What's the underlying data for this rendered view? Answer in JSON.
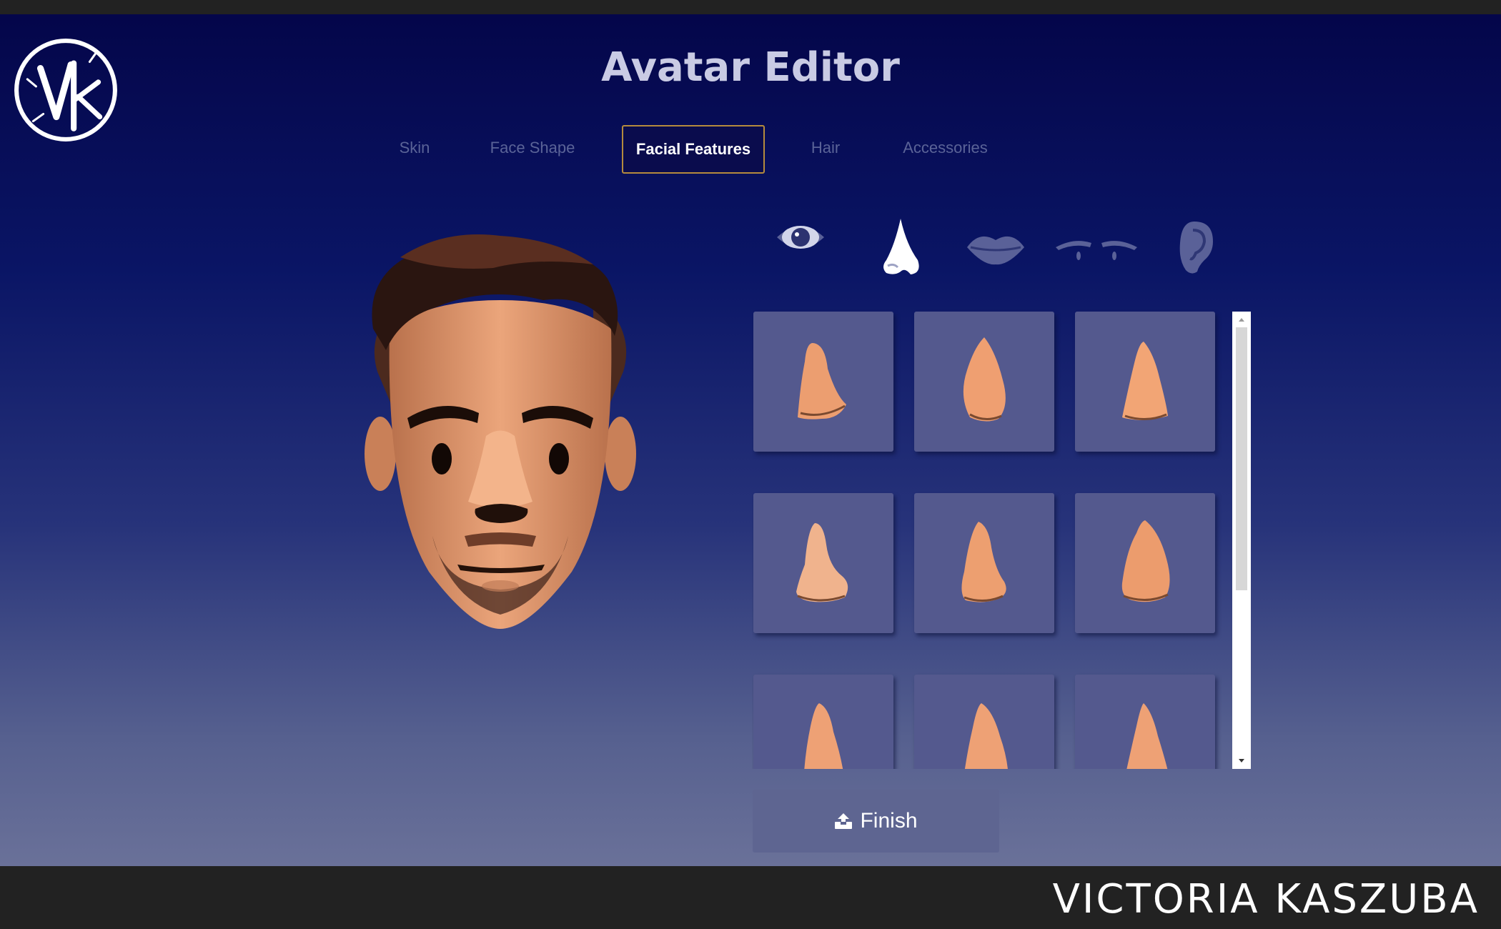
{
  "app": {
    "title": "Avatar Editor",
    "credit": "VICTORIA KASZUBA",
    "logo_text": "VK"
  },
  "tabs": [
    {
      "label": "Skin",
      "active": false
    },
    {
      "label": "Face Shape",
      "active": false
    },
    {
      "label": "Facial Features",
      "active": true
    },
    {
      "label": "Hair",
      "active": false
    },
    {
      "label": "Accessories",
      "active": false
    }
  ],
  "feature_icons": [
    {
      "name": "eye-icon",
      "selected": false
    },
    {
      "name": "nose-icon",
      "selected": true
    },
    {
      "name": "lips-icon",
      "selected": false
    },
    {
      "name": "eyebrows-icon",
      "selected": false
    },
    {
      "name": "ear-icon",
      "selected": false
    }
  ],
  "grid": {
    "item_type": "nose-shape",
    "visible_options": 9,
    "columns": 3
  },
  "finish_button": {
    "label": "Finish",
    "icon": "upload-icon"
  },
  "colors": {
    "background_top": "#04064a",
    "background_bottom": "#6a7199",
    "tab_active_border": "#b58b3d",
    "tile": "#54598e",
    "skin": "#e9a77c",
    "footer": "#222222"
  }
}
